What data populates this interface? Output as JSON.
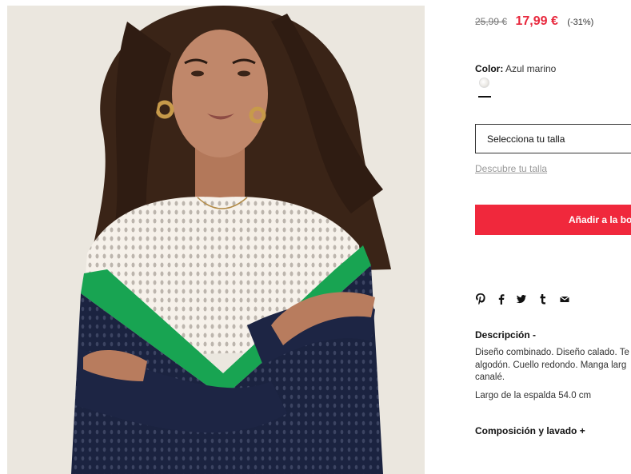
{
  "product": {
    "image_alt": "Jersey combinado calado",
    "price": {
      "old": "25,99 €",
      "new": "17,99 €",
      "discount": "(-31%)"
    },
    "color": {
      "label": "Color:",
      "value": "Azul marino"
    },
    "size": {
      "placeholder": "Selecciona tu talla",
      "guide_link": "Descubre tu talla"
    },
    "add_to_bag": "Añadir a la bol",
    "share_icons": [
      "pinterest-icon",
      "facebook-icon",
      "twitter-icon",
      "tumblr-icon",
      "email-icon"
    ],
    "description": {
      "title": "Descripción -",
      "text": "Diseño combinado. Diseño calado. Te algodón. Cuello redondo. Manga larg canalé.",
      "back_length": "Largo de la espalda 54.0 cm"
    },
    "composition_title": "Composición y lavado +"
  },
  "colors": {
    "accent": "#f0283c",
    "price_red": "#e8283d",
    "text": "#222222"
  }
}
